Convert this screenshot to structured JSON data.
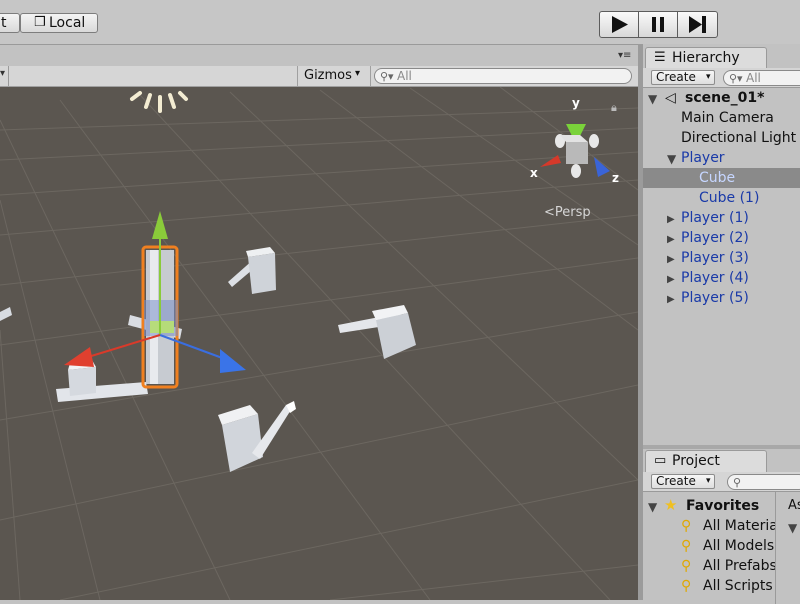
{
  "toolbar": {
    "pivot_label": "t",
    "local_label": "Local"
  },
  "scene": {
    "gizmos_label": "Gizmos",
    "search_placeholder": "All",
    "persp_label": "Persp",
    "axis_x": "x",
    "axis_y": "y",
    "axis_z": "z"
  },
  "hierarchy": {
    "tab_label": "Hierarchy",
    "create_label": "Create",
    "search_placeholder": "All",
    "scene_name": "scene_01*",
    "items": [
      {
        "label": "Main Camera",
        "prefab": false
      },
      {
        "label": "Directional Light",
        "prefab": false
      },
      {
        "label": "Player",
        "prefab": true,
        "expanded": true
      },
      {
        "label": "Cube",
        "prefab": true,
        "selected": true
      },
      {
        "label": "Cube (1)",
        "prefab": true
      },
      {
        "label": "Player (1)",
        "prefab": true
      },
      {
        "label": "Player (2)",
        "prefab": true
      },
      {
        "label": "Player (3)",
        "prefab": true
      },
      {
        "label": "Player (4)",
        "prefab": true
      },
      {
        "label": "Player (5)",
        "prefab": true
      }
    ]
  },
  "project": {
    "tab_label": "Project",
    "create_label": "Create",
    "favorites_label": "Favorites",
    "assets_partial": "As",
    "favorites": [
      "All Materia",
      "All Models",
      "All Prefabs",
      "All Scripts"
    ]
  },
  "colors": {
    "scene_bg": "#5b5650",
    "prefab_blue": "#1a3aa8",
    "selection_bg": "#8a8a8a",
    "selection_orange": "#f08020"
  }
}
